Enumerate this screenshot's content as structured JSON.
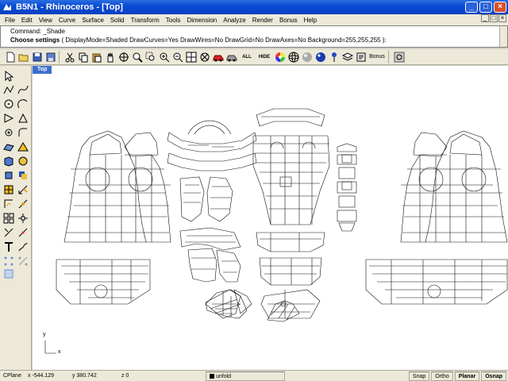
{
  "window": {
    "title": "B5N1 - Rhinoceros - [Top]",
    "buttons": {
      "minimize": "_",
      "maximize": "□",
      "close": "×"
    }
  },
  "menu": [
    "File",
    "Edit",
    "View",
    "Curve",
    "Surface",
    "Solid",
    "Transform",
    "Tools",
    "Dimension",
    "Analyze",
    "Render",
    "Bonus",
    "Help"
  ],
  "command": {
    "line1": "Command: _Shade",
    "prompt": "Choose settings",
    "options_text": "( DisplayMode=Shaded  DrawCurves=Yes  DrawWires=No  DrawGrid=No  DrawAxes=No  Background=255,255,255 ):"
  },
  "toolbar": {
    "all_label": "ALL",
    "hide_label": "HIDE",
    "bonus_label": "Bonus",
    "icons": [
      "new-icon",
      "open-icon",
      "save-icon",
      "save-as-icon",
      "cut-icon",
      "copy-icon",
      "paste-icon",
      "pan-icon",
      "rotate-view-icon",
      "zoom-icon",
      "zoom-window-icon",
      "zoom-extents-icon",
      "zoom-selected-icon",
      "four-views-icon",
      "grid-icon",
      "car-icon",
      "render-icon",
      "show-all-icon",
      "hide-icon",
      "color-wheel-icon",
      "sphere-icon",
      "sphere-gray-icon",
      "sphere-blue-icon",
      "pin-icon",
      "layer-icon",
      "properties-icon",
      "bonus-icon",
      "options-icon"
    ]
  },
  "viewport": {
    "tab_label": "Top",
    "axis_x": "x",
    "axis_y": "y"
  },
  "status": {
    "cplane": "CPlane",
    "x": "x -544.129",
    "y": "y 380.742",
    "z": "z 0",
    "layer": "unfold",
    "snap": "Snap",
    "ortho": "Ortho",
    "planar": "Planar",
    "osnap": "Osnap"
  },
  "colors": {
    "titlebar": "#0a4cd4",
    "viewport_bg": "#ffffff",
    "vptab": "#3d6fcf",
    "chrome": "#ece9d8"
  }
}
